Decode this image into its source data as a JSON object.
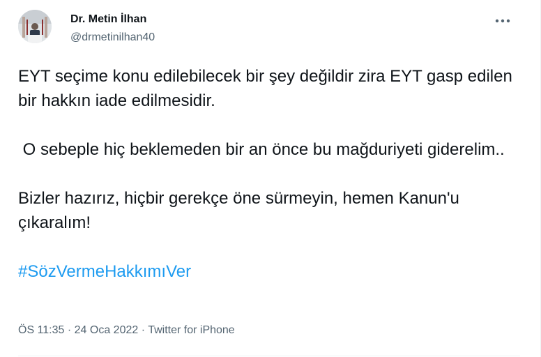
{
  "author": {
    "display_name": "Dr. Metin İlhan",
    "handle": "@drmetinilhan40"
  },
  "tweet": {
    "paragraphs": [
      "EYT seçime konu edilebilecek bir şey değildir zira EYT gasp edilen bir hakkın iade edilmesidir.",
      " O sebeple hiç beklemeden bir an önce bu mağduriyeti giderelim..",
      "Bizler hazırız, hiçbir gerekçe öne sürmeyin, hemen Kanun'u çıkaralım!"
    ],
    "hashtag": "#SözVermeHakkımıVer"
  },
  "meta": {
    "time": "ÖS 11:35",
    "separator1": " · ",
    "date": "24 Oca 2022",
    "separator2": " · ",
    "source": "Twitter for iPhone"
  },
  "icons": {
    "more": "more-horizontal-icon",
    "avatar": "profile-photo"
  },
  "colors": {
    "text": "#0f1419",
    "secondary": "#536471",
    "link": "#1d9bf0",
    "divider": "#eff3f4"
  }
}
